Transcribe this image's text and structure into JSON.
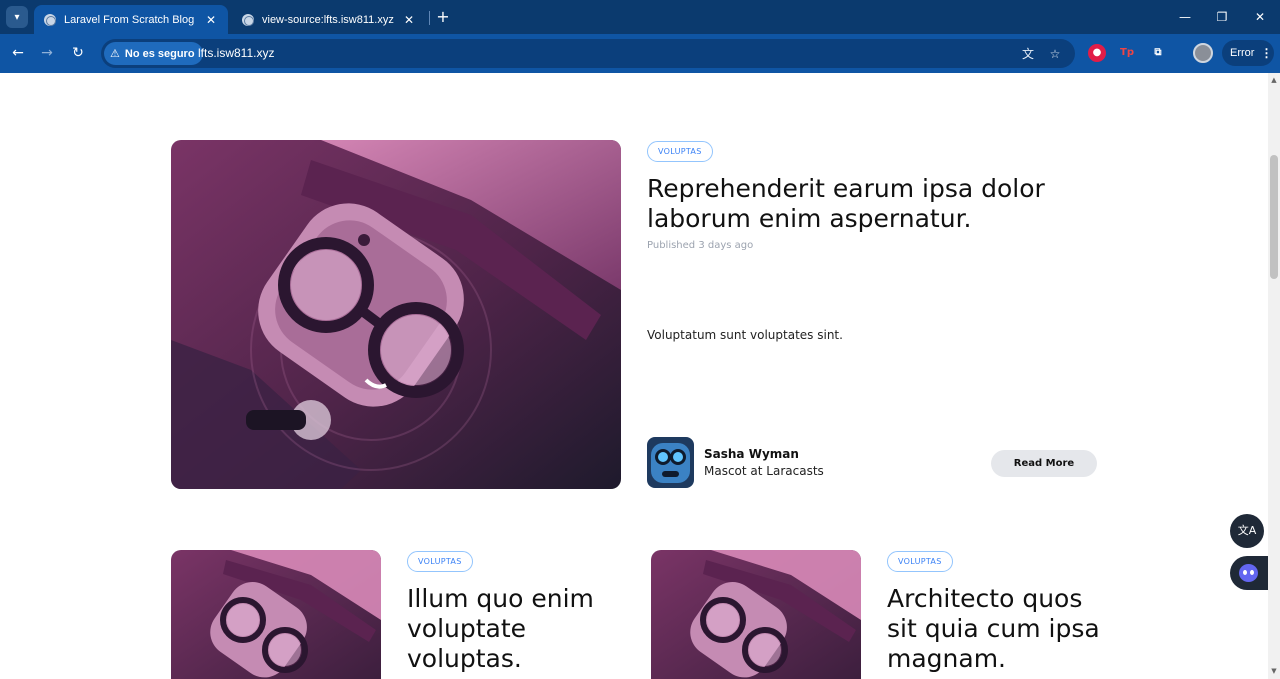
{
  "browser": {
    "tabs": [
      {
        "title": "Laravel From Scratch Blog",
        "active": true
      },
      {
        "title": "view-source:lfts.isw811.xyz",
        "active": false
      }
    ],
    "security_label": "No es seguro",
    "url": "lfts.isw811.xyz",
    "profile_status": "Error",
    "extensions": [
      "Tp"
    ]
  },
  "featured_post": {
    "category": "VOLUPTAS",
    "title": "Reprehenderit earum ipsa dolor laborum enim aspernatur.",
    "published": "Published 3 days ago",
    "excerpt": "Voluptatum sunt voluptates sint.",
    "author_name": "Sasha Wyman",
    "author_role": "Mascot at Laracasts",
    "read_more": "Read More"
  },
  "posts": [
    {
      "category": "VOLUPTAS",
      "title": "Illum quo enim voluptate voluptas."
    },
    {
      "category": "VOLUPTAS",
      "title": "Architecto quos sit quia cum ipsa magnam."
    }
  ],
  "colors": {
    "chrome_dark": "#0b3a6e",
    "chrome_blue": "#0f55a4",
    "tag_blue": "#3b82f6",
    "button_gray": "#e5e7eb"
  }
}
